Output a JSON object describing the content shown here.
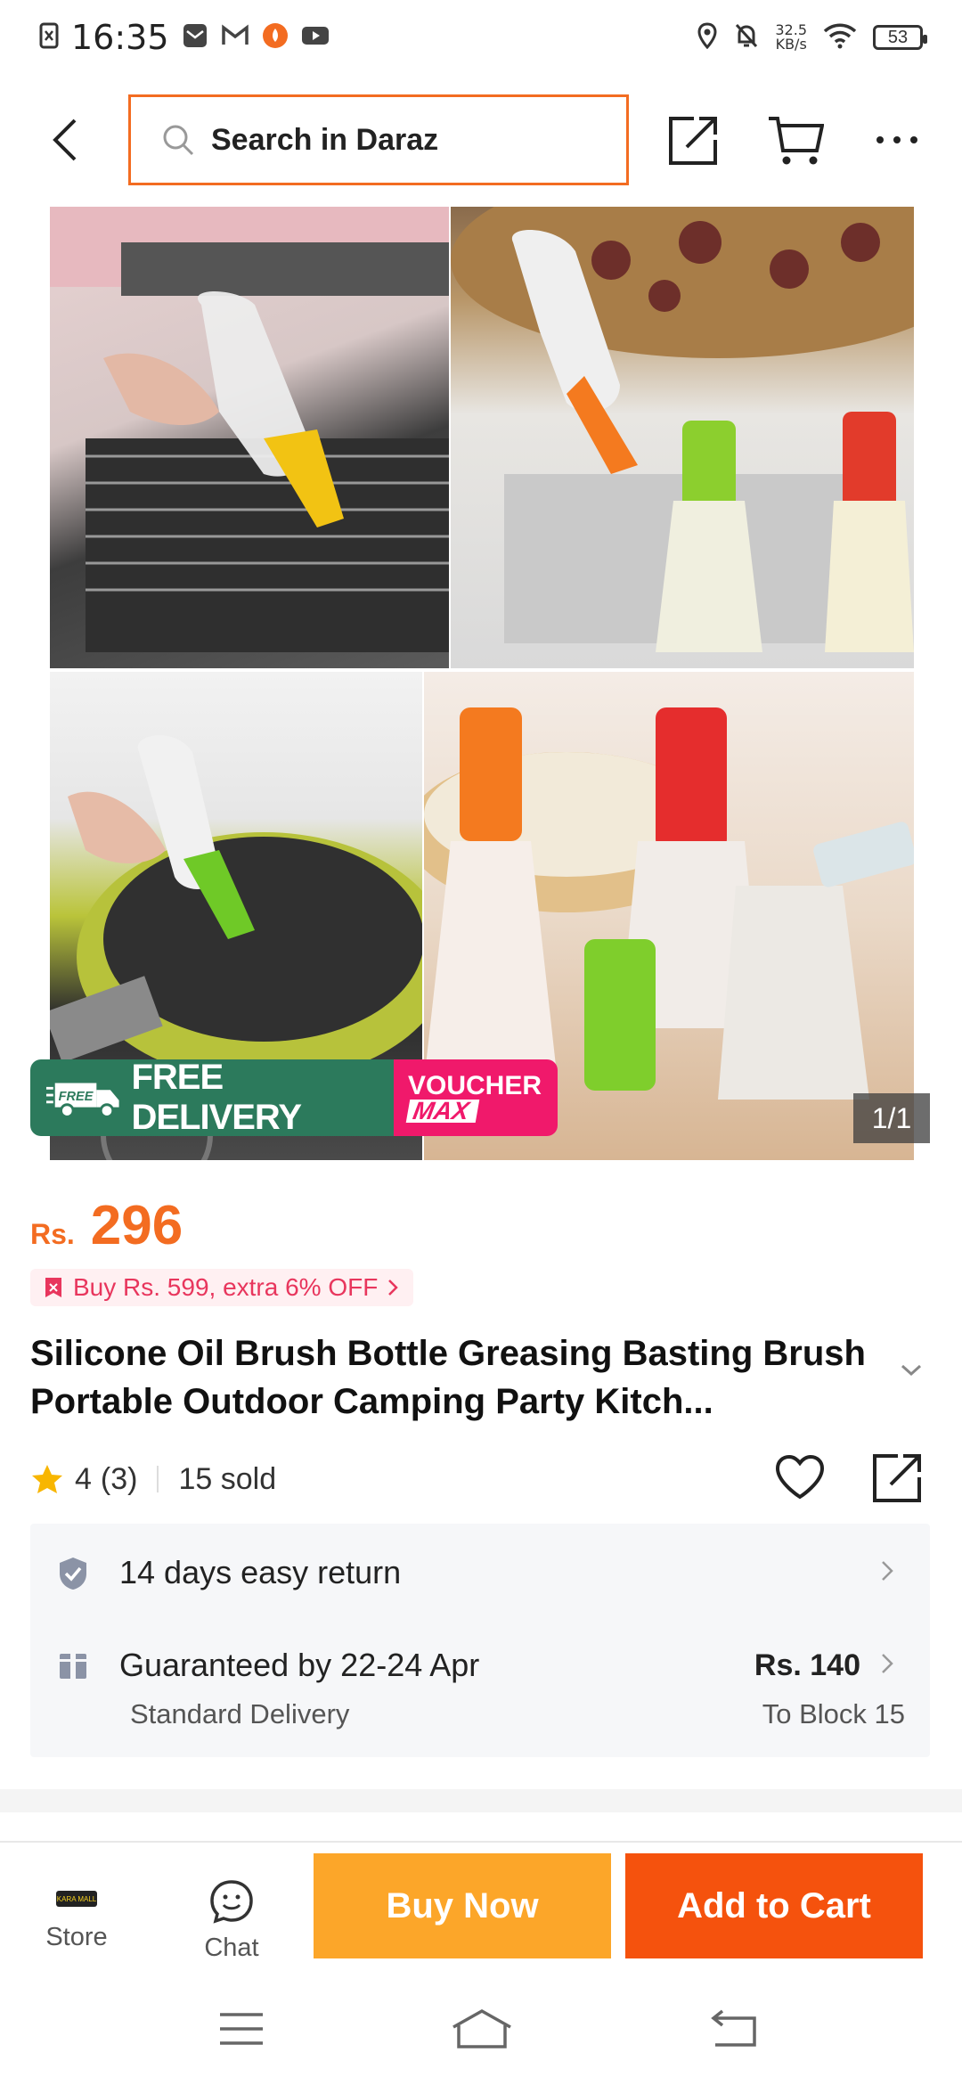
{
  "status_bar": {
    "time": "16:35",
    "net_speed_value": "32.5",
    "net_speed_unit": "KB/s",
    "battery": "53"
  },
  "top_nav": {
    "search_placeholder": "Search in Daraz"
  },
  "gallery": {
    "counter": "1/1",
    "badge_free_delivery": "FREE DELIVERY",
    "badge_free_tag": "FREE",
    "badge_voucher_line1": "VOUCHER",
    "badge_voucher_line2": "MAX"
  },
  "product": {
    "currency": "Rs.",
    "price": "296",
    "promo_text": "Buy Rs. 599, extra 6% OFF",
    "title": "Silicone Oil Brush Bottle Greasing Basting Brush Portable Outdoor Camping Party Kitch...",
    "rating": "4",
    "rating_count": "(3)",
    "sold": "15 sold"
  },
  "services": {
    "return_text": "14 days easy return",
    "delivery_guarantee": "Guaranteed by 22-24 Apr",
    "delivery_type": "Standard Delivery",
    "delivery_fee": "Rs. 140",
    "delivery_destination": "To Block 15"
  },
  "action_bar": {
    "store_label": "Store",
    "store_logo_text": "KARA MALL",
    "chat_label": "Chat",
    "buy_now_label": "Buy Now",
    "add_to_cart_label": "Add to Cart"
  },
  "colors": {
    "brand_orange": "#f36c21",
    "buy_now": "#fca629",
    "add_to_cart": "#f5520d",
    "free_delivery_green": "#2c7a5c",
    "voucher_pink": "#f0196b",
    "star": "#f8b600"
  }
}
